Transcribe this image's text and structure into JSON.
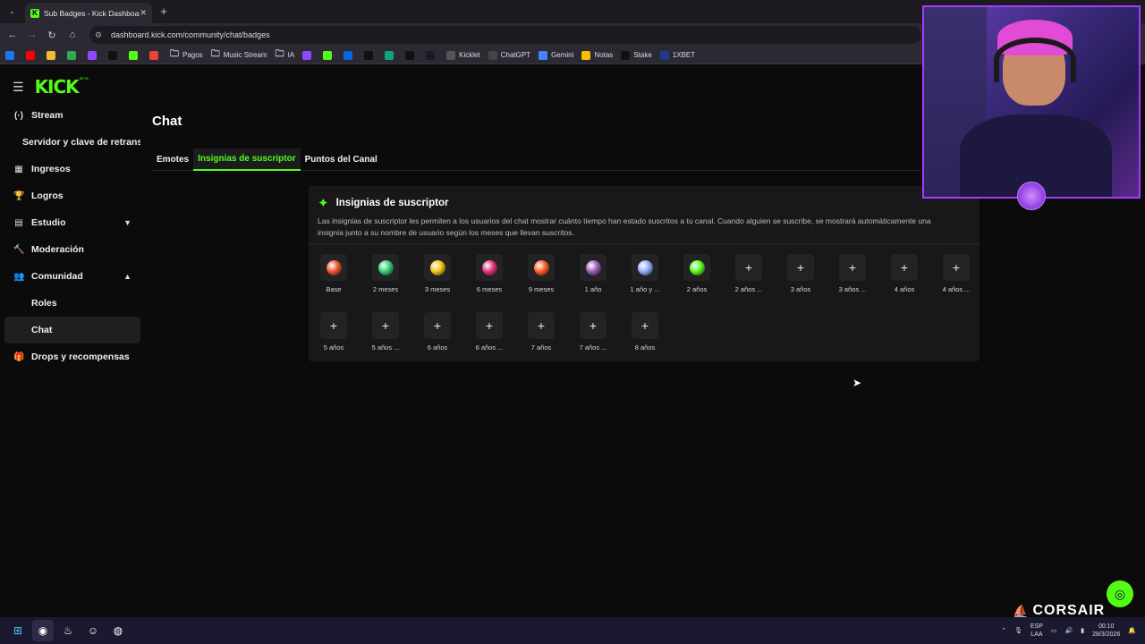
{
  "browser": {
    "tab_title": "Sub Badges - Kick Dashboard",
    "tab_close": "✕",
    "new_tab": "+",
    "url": "dashboard.kick.com/community/chat/badges",
    "bookmarks": [
      {
        "label": "",
        "color": "#1877f2"
      },
      {
        "label": "",
        "color": "#ff0000"
      },
      {
        "label": "",
        "color": "#f3ba2f"
      },
      {
        "label": "",
        "color": "#34a853"
      },
      {
        "label": "",
        "color": "#9146ff"
      },
      {
        "label": "",
        "color": "#111111"
      },
      {
        "label": "",
        "color": "#53fc18"
      },
      {
        "label": "",
        "color": "#ea4335"
      },
      {
        "label": "Pagos",
        "color": "folder"
      },
      {
        "label": "Music Stream",
        "color": "folder"
      },
      {
        "label": "IA",
        "color": "folder"
      },
      {
        "label": "",
        "color": "#9146ff"
      },
      {
        "label": "",
        "color": "#53fc18"
      },
      {
        "label": "",
        "color": "#0668e1"
      },
      {
        "label": "",
        "color": "#111111"
      },
      {
        "label": "",
        "color": "#10a37f"
      },
      {
        "label": "",
        "color": "#111111"
      },
      {
        "label": "",
        "color": "#1c1b22"
      },
      {
        "label": "Kicklet",
        "color": "#555555"
      },
      {
        "label": "ChatGPT",
        "color": "#444444"
      },
      {
        "label": "Gemini",
        "color": "#4285f4"
      },
      {
        "label": "Notas",
        "color": "#fbbc04"
      },
      {
        "label": "Stake",
        "color": "#111111"
      },
      {
        "label": "1XBET",
        "color": "#1e3a8a"
      }
    ]
  },
  "sidebar": {
    "logo": "KICK",
    "logo_sup": "BETA",
    "items": [
      {
        "label": "Stream",
        "icon": "(·)"
      },
      {
        "label": "Servidor y clave de retransmisión",
        "icon": ""
      },
      {
        "label": "Ingresos",
        "icon": "▦"
      },
      {
        "label": "Logros",
        "icon": "🏆"
      },
      {
        "label": "Estudio",
        "icon": "▤"
      },
      {
        "label": "Moderación",
        "icon": "🔨"
      },
      {
        "label": "Comunidad",
        "icon": "👥"
      },
      {
        "label": "Roles",
        "icon": ""
      },
      {
        "label": "Chat",
        "icon": ""
      },
      {
        "label": "Drops y recompensas",
        "icon": "🎁"
      }
    ]
  },
  "main": {
    "title": "Chat",
    "tabs": [
      "Emotes",
      "Insignias de suscriptor",
      "Puntos del Canal"
    ],
    "panel": {
      "title": "Insignias de suscriptor",
      "description": "Las insignias de suscriptor les permiten a los usuarios del chat mostrar cuánto tiempo han estado suscritos a tu canal. Cuando alguien se suscribe, se mostrará automáticamente una insignia junto a su nombre de usuario según los meses que llevan suscritos.",
      "badges": [
        {
          "label": "Base",
          "set": true,
          "color": "#e8522b"
        },
        {
          "label": "2 meses",
          "set": true,
          "color": "#2ecc71"
        },
        {
          "label": "3 meses",
          "set": true,
          "color": "#f1c40f"
        },
        {
          "label": "6 meses",
          "set": true,
          "color": "#e0307a"
        },
        {
          "label": "9 meses",
          "set": true,
          "color": "#ff5a1f"
        },
        {
          "label": "1 año",
          "set": true,
          "color": "#9b59b6"
        },
        {
          "label": "1 año y ...",
          "set": true,
          "color": "#8fa8ff"
        },
        {
          "label": "2 años",
          "set": true,
          "color": "#53fc18"
        },
        {
          "label": "2 años ...",
          "set": false
        },
        {
          "label": "3 años",
          "set": false
        },
        {
          "label": "3 años ...",
          "set": false
        },
        {
          "label": "4 años",
          "set": false
        },
        {
          "label": "4 años ...",
          "set": false
        },
        {
          "label": "5 años",
          "set": false
        },
        {
          "label": "5 años ...",
          "set": false
        },
        {
          "label": "6 años",
          "set": false
        },
        {
          "label": "6 años ...",
          "set": false
        },
        {
          "label": "7 años",
          "set": false
        },
        {
          "label": "7 años ...",
          "set": false
        },
        {
          "label": "8 años",
          "set": false
        }
      ],
      "add_glyph": "+"
    }
  },
  "overlay": {
    "brand": "CORSAIR"
  },
  "taskbar": {
    "lang": "ESP",
    "lang2": "LAA",
    "time": "00:10",
    "date": "28/3/2026"
  },
  "colors": {
    "accent": "#53fc18",
    "webcam_border": "#a53bff"
  }
}
